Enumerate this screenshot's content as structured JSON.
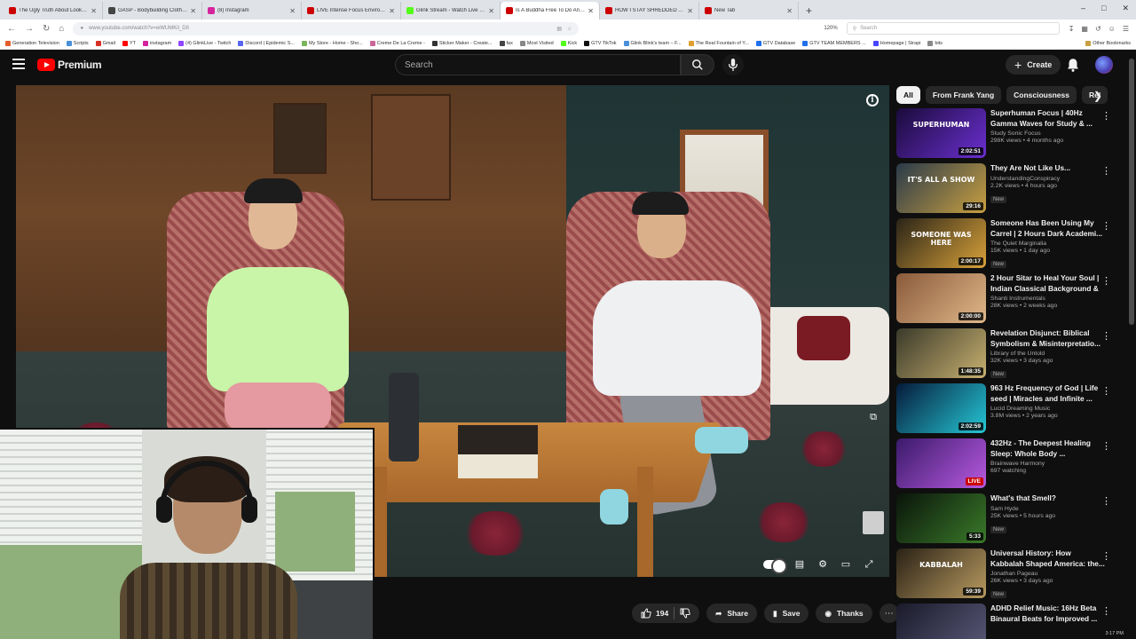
{
  "browser": {
    "tabs": [
      {
        "title": "The Ugly Truth About Lookism",
        "color": "#cc0000",
        "active": false
      },
      {
        "title": "GASP - Bodybuilding Clothing",
        "color": "#444444",
        "active": false
      },
      {
        "title": "(8) Instagram",
        "color": "#d6249f",
        "active": false
      },
      {
        "title": "LIVE Intense Focus Environm",
        "color": "#cc0000",
        "active": false
      },
      {
        "title": "Glink Stream - Watch Live on Ki",
        "color": "#53fc18",
        "active": false
      },
      {
        "title": "Is A Buddha Free To Do Anythi",
        "color": "#cc0000",
        "active": true
      },
      {
        "title": "HOW I STAY SHREDDED ALL YE",
        "color": "#cc0000",
        "active": false
      },
      {
        "title": "New Tab",
        "color": "#cc0000",
        "active": false
      }
    ],
    "url": "www.youtube.com/watch?v=wWUMKil_DII",
    "zoom": "120%",
    "search_placeholder": "Search",
    "bookmarks": [
      {
        "label": "Generation Television",
        "color": "#e35d2b"
      },
      {
        "label": "Scripts",
        "color": "#4a90d9"
      },
      {
        "label": "Gmail",
        "color": "#d93025"
      },
      {
        "label": "YT",
        "color": "#ff0000"
      },
      {
        "label": "instagram",
        "color": "#d6249f"
      },
      {
        "label": "(4) GlinkLive - Twitch",
        "color": "#9146ff"
      },
      {
        "label": "Discord | Epidemic S...",
        "color": "#5865f2"
      },
      {
        "label": "My Store - Home - Sho...",
        "color": "#7ab55c"
      },
      {
        "label": "Creme De La Creme -",
        "color": "#cc6699"
      },
      {
        "label": "Sticker Maker - Create...",
        "color": "#333333"
      },
      {
        "label": "fax",
        "color": "#444444"
      },
      {
        "label": "Most Visited",
        "color": "#888888"
      },
      {
        "label": "Kick",
        "color": "#53fc18"
      },
      {
        "label": "GTV TikTok",
        "color": "#111111"
      },
      {
        "label": "Glink Blink's team – F...",
        "color": "#4a90d9"
      },
      {
        "label": "The Real Fountain of Y...",
        "color": "#e0a030"
      },
      {
        "label": "GTV Database",
        "color": "#1f6feb"
      },
      {
        "label": "GTV TEAM MEMBERS ...",
        "color": "#1f6feb"
      },
      {
        "label": "Homepage | Strapi",
        "color": "#4945ff"
      },
      {
        "label": "bits",
        "color": "#888888"
      }
    ],
    "other_bookmarks": "Other Bookmarks"
  },
  "header": {
    "logo_text": "Premium",
    "search_placeholder": "Search",
    "create_label": "Create"
  },
  "actions": {
    "likes": "194",
    "share": "Share",
    "save": "Save",
    "thanks": "Thanks"
  },
  "chips": [
    "All",
    "From Frank Yang",
    "Consciousness",
    "Rel"
  ],
  "recommendations": [
    {
      "title": "Superhuman Focus | 40Hz Gamma Waves for Study & ...",
      "channel": "Study Sonic Focus",
      "stats": "298K views • 4 months ago",
      "duration": "2:02:51",
      "badge": "",
      "thumb": [
        "#1a0b3a",
        "#6b2fd1"
      ],
      "thumb_text": "SUPERHUMAN"
    },
    {
      "title": "They Are Not Like Us...",
      "channel": "UnderstandingConspiracy",
      "stats": "2.2K views • 4 hours ago",
      "duration": "29:16",
      "badge": "New",
      "thumb": [
        "#2a3a4a",
        "#c9a040"
      ],
      "thumb_text": "IT'S ALL A SHOW"
    },
    {
      "title": "Someone Has Been Using My Carrel | 2 Hours Dark Academi...",
      "channel": "The Quiet Marginalia",
      "stats": "15K views • 1 day ago",
      "duration": "2:00:17",
      "badge": "New",
      "thumb": [
        "#2a2418",
        "#d9a23a"
      ],
      "thumb_text": "SOMEONE WAS HERE"
    },
    {
      "title": "2 Hour Sitar to Heal Your Soul | Indian Classical Background & ...",
      "channel": "Shanti Instrumentals",
      "stats": "28K views • 2 weeks ago",
      "duration": "2:00:00",
      "badge": "",
      "thumb": [
        "#8a5a3a",
        "#e0b88a"
      ],
      "thumb_text": ""
    },
    {
      "title": "Revelation Disjunct: Biblical Symbolism & Misinterpretatio...",
      "channel": "Library of the Untold",
      "stats": "32K views • 3 days ago",
      "duration": "1:48:35",
      "badge": "New",
      "thumb": [
        "#3a3a2a",
        "#c8b070"
      ],
      "thumb_text": ""
    },
    {
      "title": "963 Hz Frequency of God | Life seed | Miracles and Infinite ...",
      "channel": "Lucid Dreaming Music",
      "stats": "3.8M views • 2 years ago",
      "duration": "2:02:59",
      "badge": "",
      "thumb": [
        "#061a3a",
        "#25c8d6"
      ],
      "thumb_text": ""
    },
    {
      "title": "432Hz - The Deepest Healing Sleep: Whole Body ...",
      "channel": "Brainwave Harmony",
      "stats": "697 watching",
      "duration": "",
      "badge": "LIVE",
      "thumb": [
        "#3a1a6a",
        "#b85ae0"
      ],
      "thumb_text": ""
    },
    {
      "title": "What's that Smell?",
      "channel": "Sam Hyde",
      "stats": "25K views • 5 hours ago",
      "duration": "5:33",
      "badge": "New",
      "thumb": [
        "#0a140a",
        "#3a7a2a"
      ],
      "thumb_text": ""
    },
    {
      "title": "Universal History: How Kabbalah Shaped America: the...",
      "channel": "Jonathan Pageau",
      "stats": "26K views • 3 days ago",
      "duration": "59:39",
      "badge": "New",
      "thumb": [
        "#2a2216",
        "#b89a60"
      ],
      "thumb_text": "KABBALAH"
    },
    {
      "title": "ADHD Relief Music: 16Hz Beta Binaural Beats for Improved ...",
      "channel": "",
      "stats": "",
      "duration": "",
      "badge": "",
      "thumb": [
        "#1a1a2a",
        "#5a5a7a"
      ],
      "thumb_text": ""
    }
  ],
  "clock": "3:17 PM",
  "colors": {
    "accent": "#ff0000",
    "bg": "#0f0f0f",
    "chip": "#272727"
  }
}
